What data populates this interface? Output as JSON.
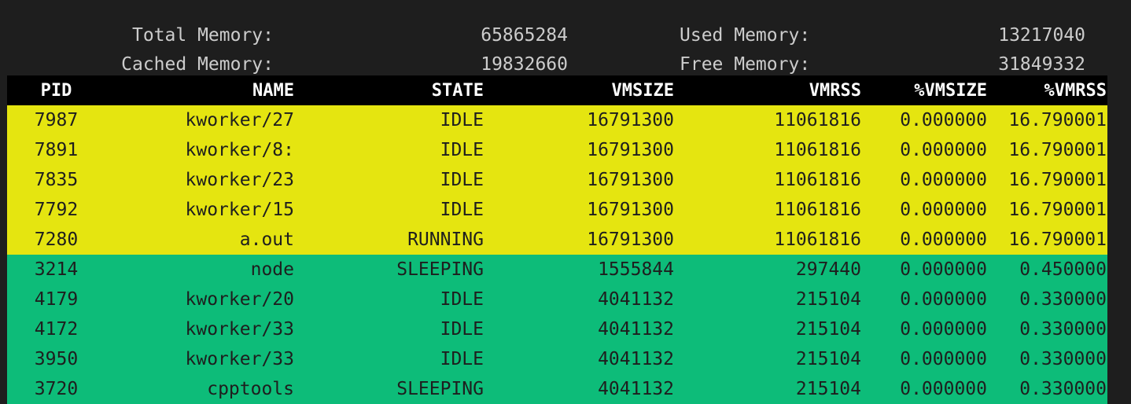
{
  "summary": {
    "total_memory_label": "Total Memory:",
    "total_memory_value": "65865284",
    "used_memory_label": "Used Memory:",
    "used_memory_value": "13217040",
    "cached_memory_label": "Cached Memory:",
    "cached_memory_value": "19832660",
    "free_memory_label": "Free Memory:",
    "free_memory_value": "31849332"
  },
  "colors": {
    "background": "#1e1e1e",
    "text": "#cccccc",
    "header_bg": "#000000",
    "header_text": "#ffffff",
    "high_memory_row_bg": "#e5e510",
    "low_memory_row_bg": "#0dbc79",
    "row_text": "#1e1e1e"
  },
  "table": {
    "headers": [
      "PID",
      "NAME",
      "STATE",
      "VMSIZE",
      "VMRSS",
      "%VMSIZE",
      "%VMRSS"
    ],
    "rows": [
      {
        "pid": "7987",
        "name": "kworker/27",
        "state": "IDLE",
        "vmsize": "16791300",
        "vmrss": "11061816",
        "pct_vmsize": "0.000000",
        "pct_vmrss": "16.790001",
        "highlight": "high"
      },
      {
        "pid": "7891",
        "name": "kworker/8:",
        "state": "IDLE",
        "vmsize": "16791300",
        "vmrss": "11061816",
        "pct_vmsize": "0.000000",
        "pct_vmrss": "16.790001",
        "highlight": "high"
      },
      {
        "pid": "7835",
        "name": "kworker/23",
        "state": "IDLE",
        "vmsize": "16791300",
        "vmrss": "11061816",
        "pct_vmsize": "0.000000",
        "pct_vmrss": "16.790001",
        "highlight": "high"
      },
      {
        "pid": "7792",
        "name": "kworker/15",
        "state": "IDLE",
        "vmsize": "16791300",
        "vmrss": "11061816",
        "pct_vmsize": "0.000000",
        "pct_vmrss": "16.790001",
        "highlight": "high"
      },
      {
        "pid": "7280",
        "name": "a.out",
        "state": "RUNNING",
        "vmsize": "16791300",
        "vmrss": "11061816",
        "pct_vmsize": "0.000000",
        "pct_vmrss": "16.790001",
        "highlight": "high"
      },
      {
        "pid": "3214",
        "name": "node",
        "state": "SLEEPING",
        "vmsize": "1555844",
        "vmrss": "297440",
        "pct_vmsize": "0.000000",
        "pct_vmrss": "0.450000",
        "highlight": "low"
      },
      {
        "pid": "4179",
        "name": "kworker/20",
        "state": "IDLE",
        "vmsize": "4041132",
        "vmrss": "215104",
        "pct_vmsize": "0.000000",
        "pct_vmrss": "0.330000",
        "highlight": "low"
      },
      {
        "pid": "4172",
        "name": "kworker/33",
        "state": "IDLE",
        "vmsize": "4041132",
        "vmrss": "215104",
        "pct_vmsize": "0.000000",
        "pct_vmrss": "0.330000",
        "highlight": "low"
      },
      {
        "pid": "3950",
        "name": "kworker/33",
        "state": "IDLE",
        "vmsize": "4041132",
        "vmrss": "215104",
        "pct_vmsize": "0.000000",
        "pct_vmrss": "0.330000",
        "highlight": "low"
      },
      {
        "pid": "3720",
        "name": "cpptools",
        "state": "SLEEPING",
        "vmsize": "4041132",
        "vmrss": "215104",
        "pct_vmsize": "0.000000",
        "pct_vmrss": "0.330000",
        "highlight": "low"
      }
    ]
  }
}
